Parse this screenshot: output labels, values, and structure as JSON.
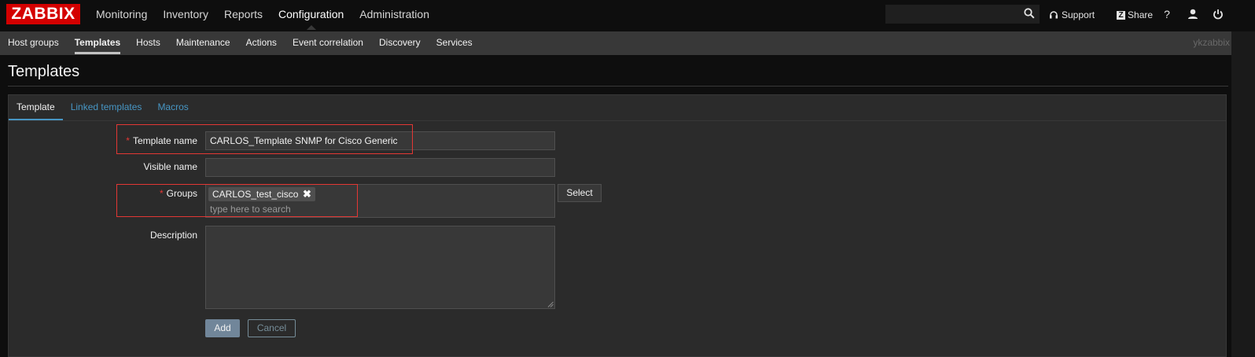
{
  "brand": {
    "logo_text": "ZABBIX",
    "color": "#d40000"
  },
  "main_nav": [
    {
      "label": "Monitoring",
      "active": false
    },
    {
      "label": "Inventory",
      "active": false
    },
    {
      "label": "Reports",
      "active": false
    },
    {
      "label": "Configuration",
      "active": true
    },
    {
      "label": "Administration",
      "active": false
    }
  ],
  "top_links": {
    "support_label": "Support",
    "share_label": "Share",
    "share_badge": "Z",
    "help_label": "?",
    "icons": [
      "search-icon",
      "headset-icon",
      "help-icon",
      "user-icon",
      "power-icon"
    ]
  },
  "sub_nav": [
    {
      "label": "Host groups",
      "active": false
    },
    {
      "label": "Templates",
      "active": true
    },
    {
      "label": "Hosts",
      "active": false
    },
    {
      "label": "Maintenance",
      "active": false
    },
    {
      "label": "Actions",
      "active": false
    },
    {
      "label": "Event correlation",
      "active": false
    },
    {
      "label": "Discovery",
      "active": false
    },
    {
      "label": "Services",
      "active": false
    }
  ],
  "username": "ykzabbix",
  "page": {
    "title": "Templates"
  },
  "tabs": [
    {
      "label": "Template",
      "active": true
    },
    {
      "label": "Linked templates",
      "active": false
    },
    {
      "label": "Macros",
      "active": false
    }
  ],
  "form": {
    "template_name": {
      "label": "Template name",
      "required_mark": "*",
      "value": "CARLOS_Template SNMP for Cisco Generic"
    },
    "visible_name": {
      "label": "Visible name",
      "value": ""
    },
    "groups": {
      "label": "Groups",
      "required_mark": "*",
      "selected": [
        "CARLOS_test_cisco"
      ],
      "remove_glyph": "✖",
      "placeholder": "type here to search",
      "select_label": "Select"
    },
    "description": {
      "label": "Description",
      "value": ""
    },
    "add_label": "Add",
    "cancel_label": "Cancel"
  },
  "colors": {
    "accent_link": "#4796c4",
    "required": "#e33734",
    "add_button": "#71869a"
  }
}
